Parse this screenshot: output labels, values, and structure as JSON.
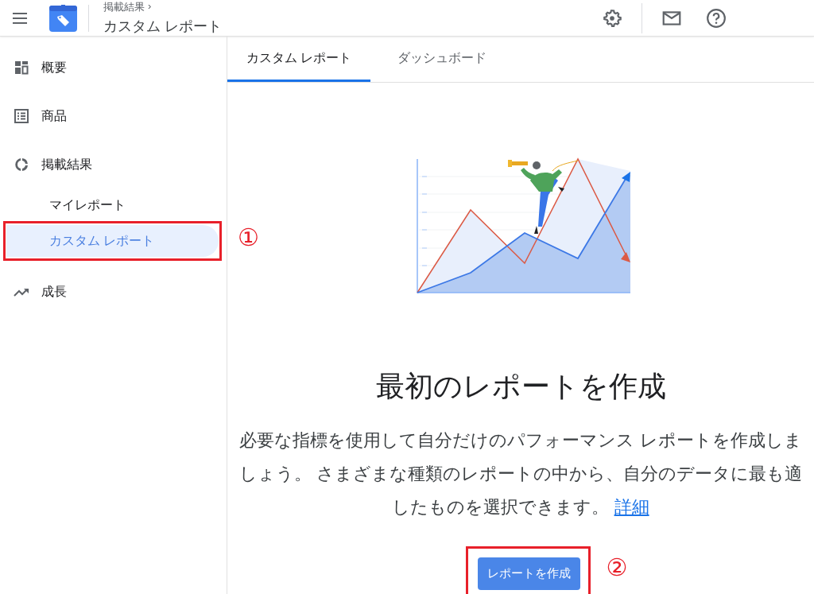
{
  "header": {
    "breadcrumb": "掲載結果",
    "breadcrumb_arrow": "›",
    "title": "カスタム レポート"
  },
  "sidebar": {
    "items": [
      {
        "label": "概要",
        "kind": "overview",
        "selected": false
      },
      {
        "label": "商品",
        "kind": "list",
        "selected": false
      },
      {
        "label": "掲載結果",
        "kind": "donut",
        "selected": false,
        "children": [
          {
            "label": "マイレポート",
            "selected": false
          },
          {
            "label": "カスタム レポート",
            "selected": true,
            "callout": "①"
          }
        ]
      },
      {
        "label": "成長",
        "kind": "trend",
        "selected": false
      }
    ]
  },
  "tabs": [
    {
      "label": "カスタム レポート",
      "selected": true
    },
    {
      "label": "ダッシュボード",
      "selected": false
    }
  ],
  "empty_state": {
    "heading": "最初のレポートを作成",
    "body": "必要な指標を使用して自分だけのパフォーマンス レポートを作成しましょう。 さまざまな種類のレポートの中から、自分のデータに最も適したものを選択できます。",
    "link": "詳細",
    "button": {
      "label": "レポートを作成",
      "callout": "②"
    }
  }
}
